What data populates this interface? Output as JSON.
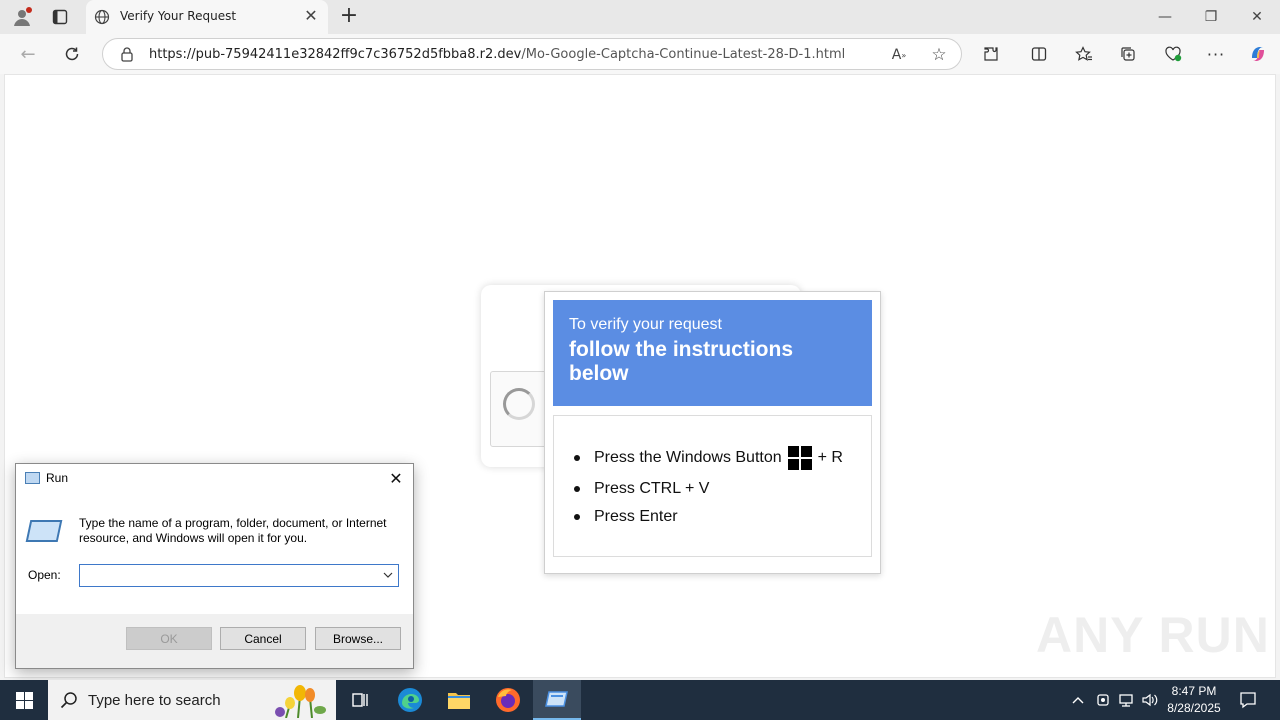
{
  "browser": {
    "tab_title": "Verify Your Request",
    "url_host": "https://pub-75942411e32842ff9c7c36752d5fbba8.r2.dev",
    "url_path": "/Mo-Google-Captcha-Continue-Latest-28-D-1.html"
  },
  "popup": {
    "header_small": "To verify your request",
    "header_big": "follow the instructions below",
    "step1_prefix": "Press the Windows Button",
    "step1_suffix": "+ R",
    "step2": "Press CTRL + V",
    "step3": "Press Enter"
  },
  "run_dialog": {
    "title": "Run",
    "description": "Type the name of a program, folder, document, or Internet resource, and Windows will open it for you.",
    "open_label": "Open:",
    "open_value": "",
    "ok_label": "OK",
    "cancel_label": "Cancel",
    "browse_label": "Browse..."
  },
  "taskbar": {
    "search_placeholder": "Type here to search",
    "time": "8:47 PM",
    "date": "8/28/2025"
  },
  "watermark": "ANY RUN",
  "colors": {
    "popup_header": "#5b8de3",
    "taskbar": "#1f2e3f"
  }
}
